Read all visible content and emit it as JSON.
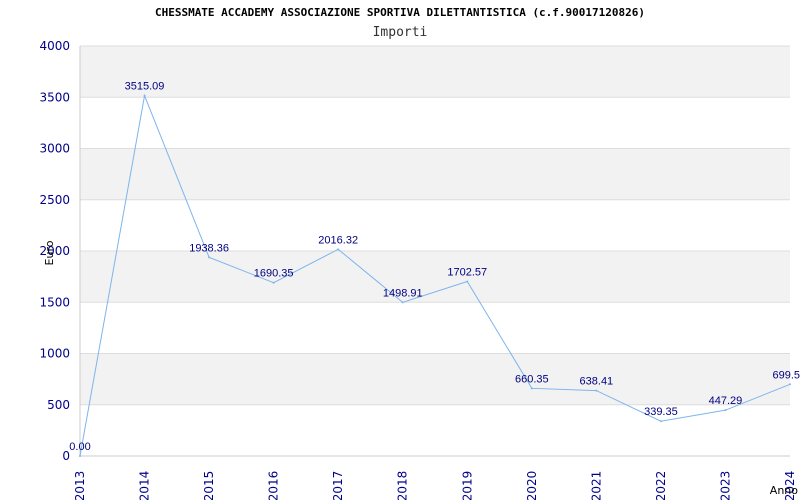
{
  "chart_data": {
    "type": "line",
    "title": "CHESSMATE ACCADEMY ASSOCIAZIONE SPORTIVA DILETTANTISTICA (c.f.90017120826)",
    "subtitle": "Importi",
    "xlabel": "Anno",
    "ylabel": "Euro",
    "x": [
      "2013",
      "2014",
      "2015",
      "2016",
      "2017",
      "2018",
      "2019",
      "2020",
      "2021",
      "2022",
      "2023",
      "2024"
    ],
    "series": [
      {
        "values": [
          0.0,
          3515.09,
          1938.36,
          1690.35,
          2016.32,
          1498.91,
          1702.57,
          660.35,
          638.41,
          339.35,
          447.29,
          699.5
        ],
        "labels": [
          "0.00",
          "3515.09",
          "1938.36",
          "1690.35",
          "2016.32",
          "1498.91",
          "1702.57",
          "660.35",
          "638.41",
          "339.35",
          "447.29",
          "699.5"
        ]
      }
    ],
    "y_ticks": [
      "0",
      "500",
      "1000",
      "1500",
      "2000",
      "2500",
      "3000",
      "3500",
      "4000"
    ],
    "ylim": [
      0,
      4000
    ],
    "grid": true,
    "colors": {
      "line": "#7cb5ec",
      "band": "#f2f2f2",
      "grid": "#dddddd",
      "tick_text": "#00008b",
      "label_text": "#000080"
    }
  }
}
